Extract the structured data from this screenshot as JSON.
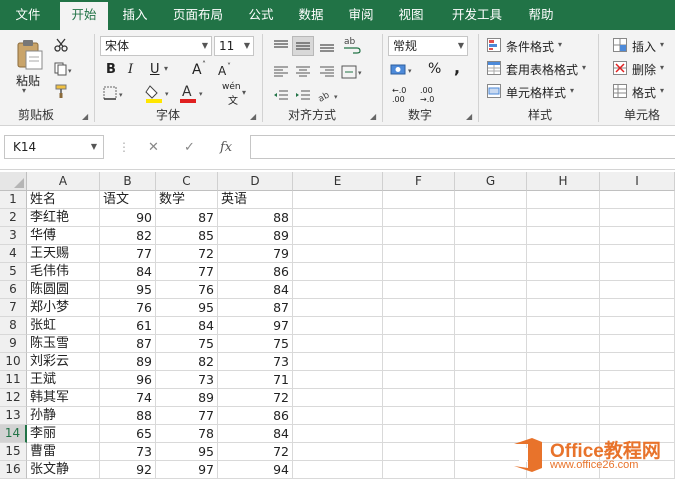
{
  "ribbon": {
    "tabs": [
      "文件",
      "开始",
      "插入",
      "页面布局",
      "公式",
      "数据",
      "审阅",
      "视图",
      "开发工具",
      "帮助"
    ],
    "active_tab": "开始",
    "clipboard": {
      "paste": "粘贴",
      "title": "剪贴板"
    },
    "font": {
      "name": "宋体",
      "size": "11",
      "bold": "B",
      "italic": "I",
      "underline": "U",
      "grow": "A",
      "shrink": "A",
      "font_color_letter": "A",
      "phonetic": "wén",
      "title": "字体"
    },
    "alignment": {
      "wrap": "ab",
      "title": "对齐方式"
    },
    "number": {
      "format": "常规",
      "percent": "%",
      "comma": ",",
      "inc_decimal": "←.0 .00",
      "dec_decimal": ".00 →.0",
      "title": "数字"
    },
    "styles": {
      "conditional": "条件格式",
      "table": "套用表格格式",
      "cell_styles": "单元格样式",
      "title": "样式"
    },
    "cells": {
      "insert": "插入",
      "delete": "删除",
      "format": "格式",
      "title": "单元格"
    }
  },
  "formula_bar": {
    "name_box": "K14",
    "cancel": "✕",
    "enter": "✓",
    "fx": "fx",
    "formula": ""
  },
  "sheet": {
    "columns": [
      "A",
      "B",
      "C",
      "D",
      "E",
      "F",
      "G",
      "H",
      "I"
    ],
    "selected_row": 14,
    "rows": [
      [
        "姓名",
        "语文",
        "数学",
        "英语"
      ],
      [
        "李红艳",
        "90",
        "87",
        "88"
      ],
      [
        "华傅",
        "82",
        "85",
        "89"
      ],
      [
        "王天赐",
        "77",
        "72",
        "79"
      ],
      [
        "毛伟伟",
        "84",
        "77",
        "86"
      ],
      [
        "陈圆圆",
        "95",
        "76",
        "84"
      ],
      [
        "郑小梦",
        "76",
        "95",
        "87"
      ],
      [
        "张虹",
        "61",
        "84",
        "97"
      ],
      [
        "陈玉雪",
        "87",
        "75",
        "75"
      ],
      [
        "刘彩云",
        "89",
        "82",
        "73"
      ],
      [
        "王斌",
        "96",
        "73",
        "71"
      ],
      [
        "韩其军",
        "74",
        "89",
        "72"
      ],
      [
        "孙静",
        "88",
        "77",
        "86"
      ],
      [
        "李丽",
        "65",
        "78",
        "84"
      ],
      [
        "曹雷",
        "73",
        "95",
        "72"
      ],
      [
        "张文静",
        "92",
        "97",
        "94"
      ]
    ]
  },
  "watermark": {
    "title": "Office教程网",
    "url": "www.office26.com"
  },
  "colors": {
    "excel_green": "#217346",
    "watermark_orange": "#e8732b",
    "font_color_bar": "#e02020",
    "fill_color_bar": "#ffe600"
  }
}
